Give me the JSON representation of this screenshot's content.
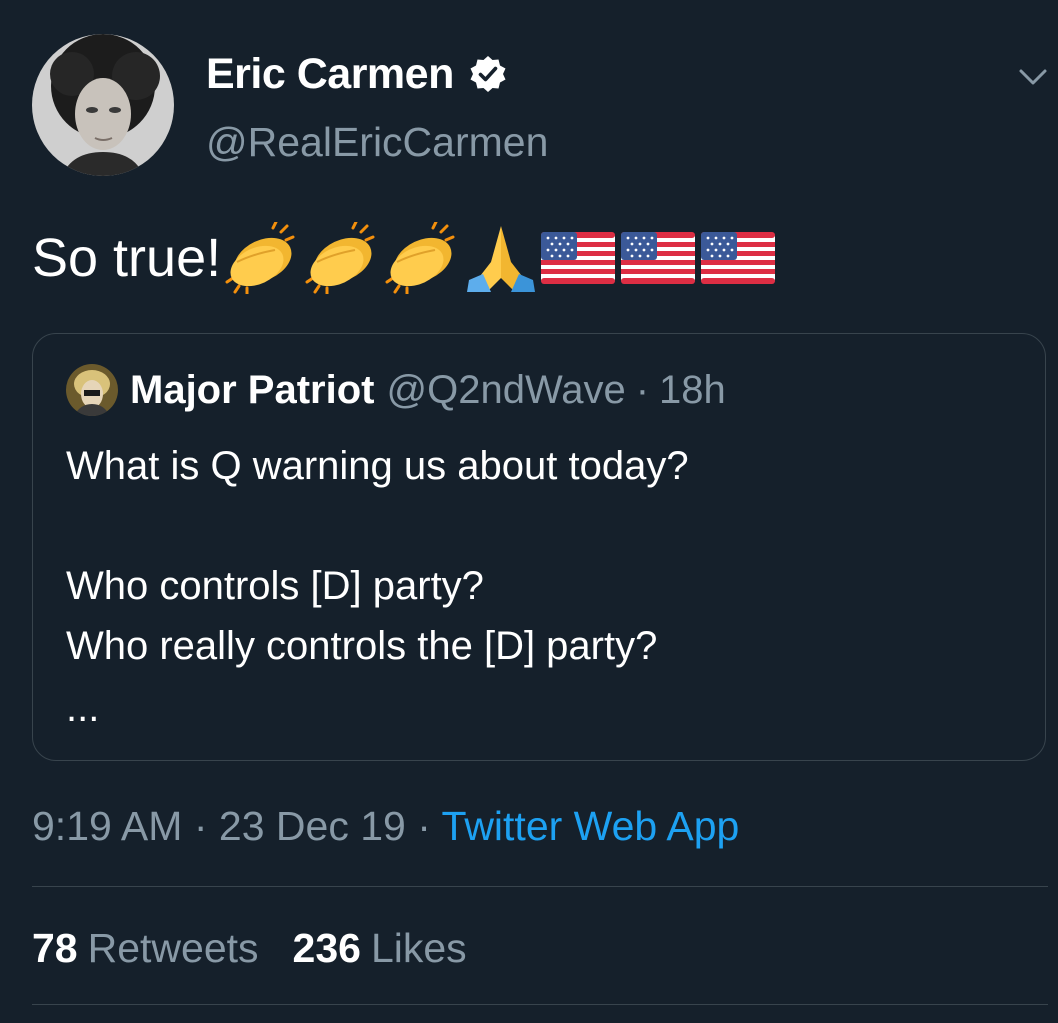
{
  "author": {
    "display_name": "Eric Carmen",
    "handle": "@RealEricCarmen",
    "verified": true
  },
  "tweet": {
    "text": "So true!",
    "emojis": [
      "clapping-hands",
      "clapping-hands",
      "clapping-hands",
      "folded-hands",
      "us-flag",
      "us-flag",
      "us-flag"
    ]
  },
  "quoted_tweet": {
    "display_name": "Major Patriot",
    "handle": "@Q2ndWave",
    "separator": "·",
    "time": "18h",
    "lines": [
      "What is Q warning us about today?",
      "Who controls [D] party?",
      "Who really controls the [D] party?",
      "..."
    ]
  },
  "meta": {
    "time": "9:19 AM",
    "separator": "·",
    "date": "23 Dec 19",
    "source": "Twitter Web App"
  },
  "stats": {
    "retweets_count": "78",
    "retweets_label": "Retweets",
    "likes_count": "236",
    "likes_label": "Likes"
  },
  "colors": {
    "background": "#15202b",
    "secondary_text": "#8899a6",
    "link": "#1da1f2",
    "border": "#38444d"
  }
}
